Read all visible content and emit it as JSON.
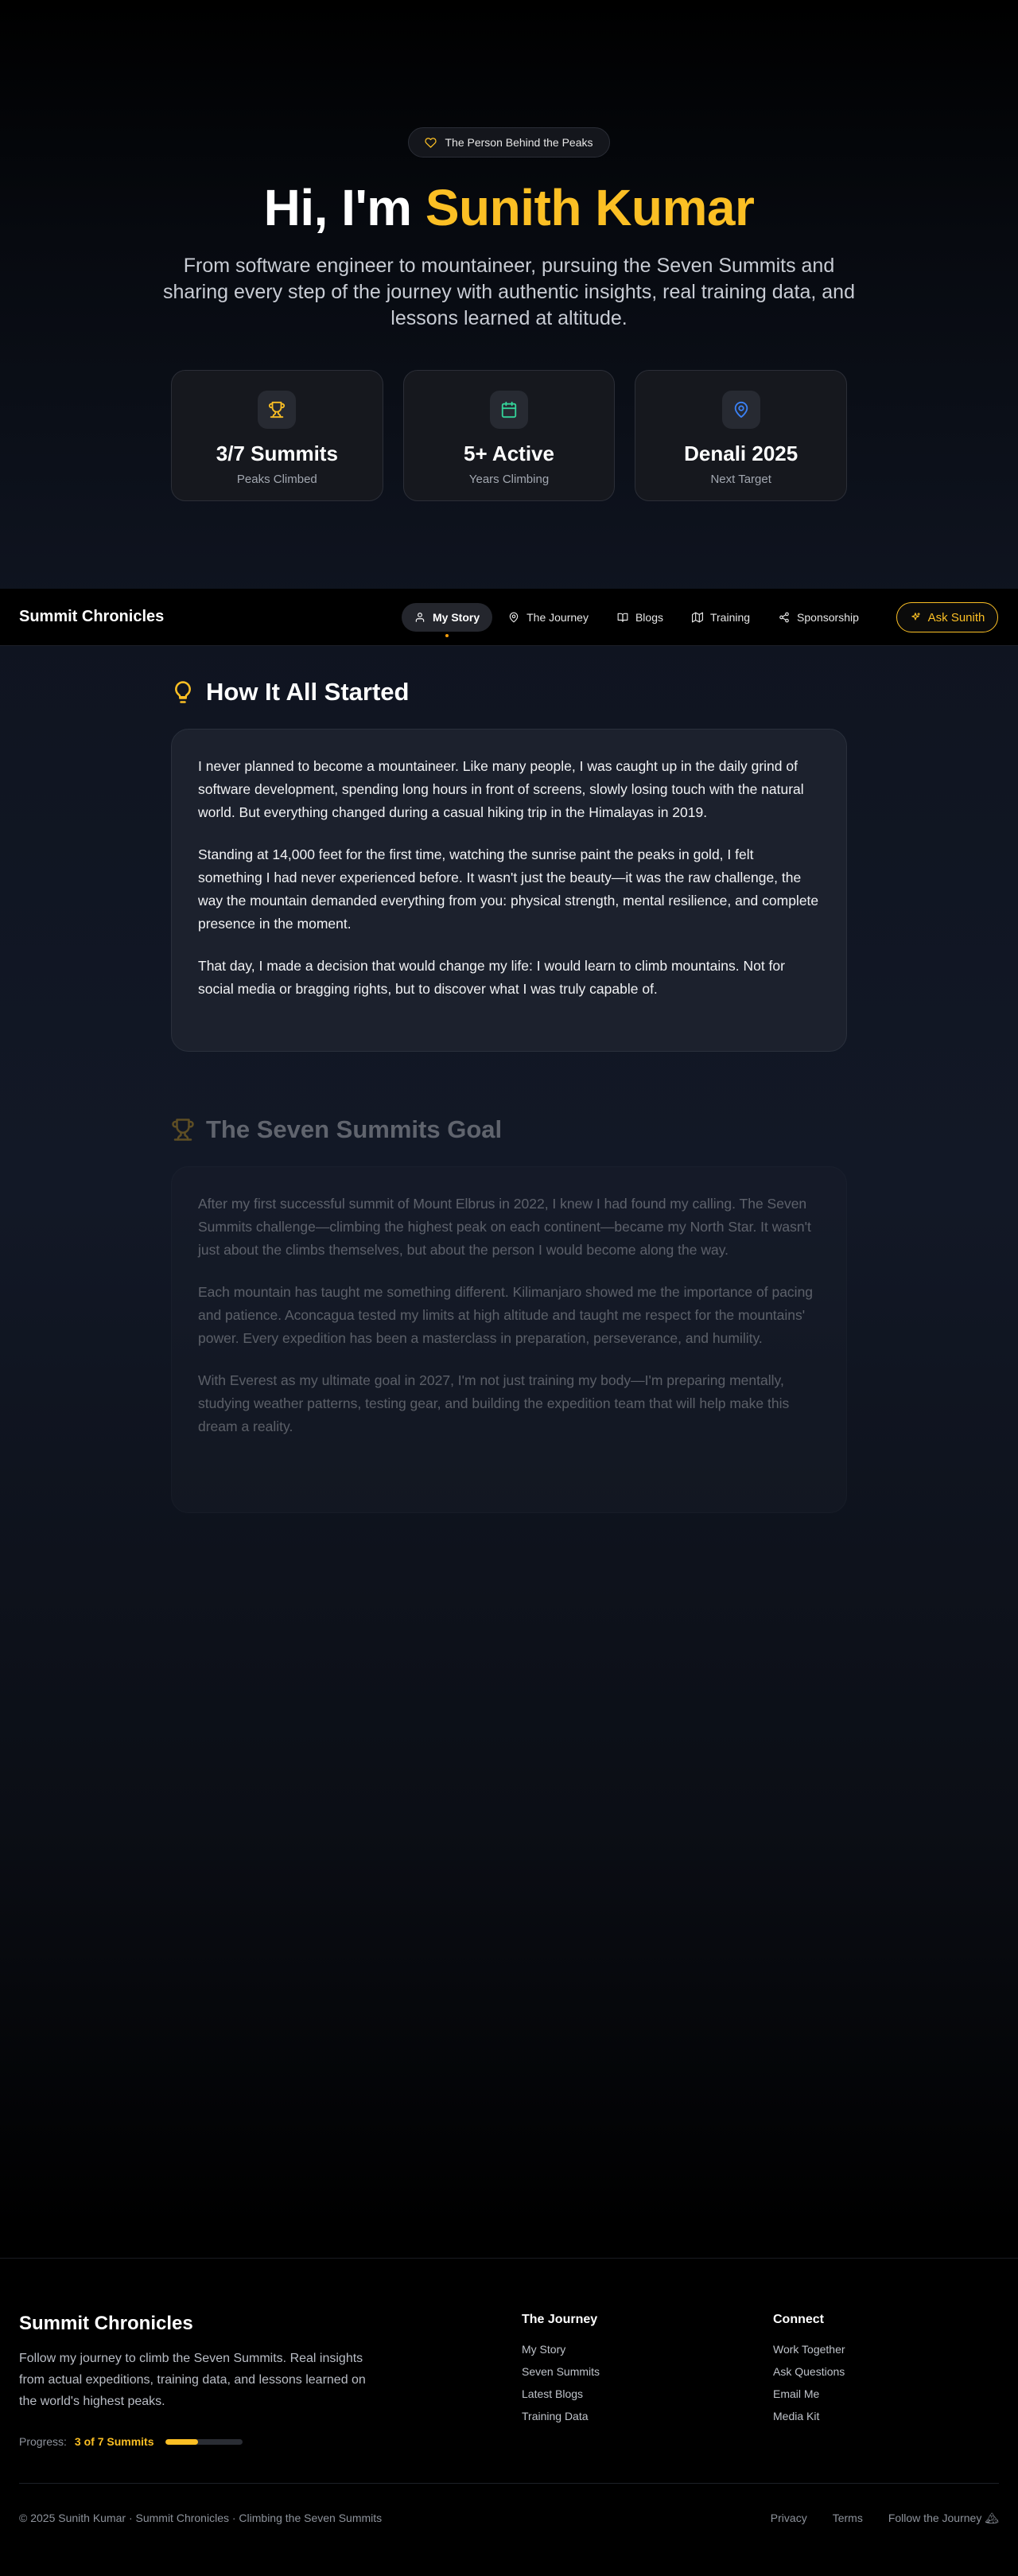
{
  "hero": {
    "badge": "The Person Behind the Peaks",
    "title_prefix": "Hi, I'm ",
    "title_name": "Sunith Kumar",
    "subtitle": "From software engineer to mountaineer, pursuing the Seven Summits and sharing every step of the journey with authentic insights, real training data, and lessons learned at altitude.",
    "stats": [
      {
        "icon": "trophy-icon",
        "value": "3/7 Summits",
        "label": "Peaks Climbed"
      },
      {
        "icon": "calendar-icon",
        "value": "5+ Active",
        "label": "Years Climbing"
      },
      {
        "icon": "map-pin-icon",
        "value": "Denali 2025",
        "label": "Next Target"
      }
    ]
  },
  "nav": {
    "brand": "Summit Chronicles",
    "items": [
      {
        "label": "My Story",
        "icon": "user-icon",
        "active": true
      },
      {
        "label": "The Journey",
        "icon": "map-pin-icon"
      },
      {
        "label": "Blogs",
        "icon": "book-icon"
      },
      {
        "label": "Training",
        "icon": "map-icon"
      },
      {
        "label": "Sponsorship",
        "icon": "share-icon"
      }
    ],
    "cta": "Ask Sunith"
  },
  "sections": [
    {
      "icon": "lightbulb-icon",
      "title": "How It All Started",
      "paragraphs": [
        "I never planned to become a mountaineer. Like many people, I was caught up in the daily grind of software development, spending long hours in front of screens, slowly losing touch with the natural world. But everything changed during a casual hiking trip in the Himalayas in 2019.",
        "Standing at 14,000 feet for the first time, watching the sunrise paint the peaks in gold, I felt something I had never experienced before. It wasn't just the beauty—it was the raw challenge, the way the mountain demanded everything from you: physical strength, mental resilience, and complete presence in the moment.",
        "That day, I made a decision that would change my life: I would learn to climb mountains. Not for social media or bragging rights, but to discover what I was truly capable of."
      ]
    },
    {
      "icon": "trophy-icon",
      "title": "The Seven Summits Goal",
      "paragraphs": [
        "After my first successful summit of Mount Elbrus in 2022, I knew I had found my calling. The Seven Summits challenge—climbing the highest peak on each continent—became my North Star. It wasn't just about the climbs themselves, but about the person I would become along the way.",
        "Each mountain has taught me something different. Kilimanjaro showed me the importance of pacing and patience. Aconcagua tested my limits at high altitude and taught me respect for the mountains' power. Every expedition has been a masterclass in preparation, perseverance, and humility.",
        "With Everest as my ultimate goal in 2027, I'm not just training my body—I'm preparing mentally, studying weather patterns, testing gear, and building the expedition team that will help make this dream a reality."
      ]
    }
  ],
  "footer": {
    "brand": "Summit Chronicles",
    "description": "Follow my journey to climb the Seven Summits. Real insights from actual expeditions, training data, and lessons learned on the world's highest peaks.",
    "progress_label": "Progress:",
    "progress_value": "3 of 7 Summits",
    "progress_fraction": 0.43,
    "journey": {
      "title": "The Journey",
      "links": [
        "My Story",
        "Seven Summits",
        "Latest Blogs",
        "Training Data"
      ]
    },
    "connect": {
      "title": "Connect",
      "links": [
        "Work Together",
        "Ask Questions",
        "Email Me",
        "Media Kit"
      ]
    },
    "copyright": "© 2025 Sunith Kumar · Summit Chronicles · Climbing the Seven Summits",
    "bottom_links": [
      "Privacy",
      "Terms",
      "Follow the Journey 🏔"
    ]
  },
  "colors": {
    "accent": "#fbbf24",
    "calendar": "#34d399",
    "pin": "#3b82f6"
  }
}
